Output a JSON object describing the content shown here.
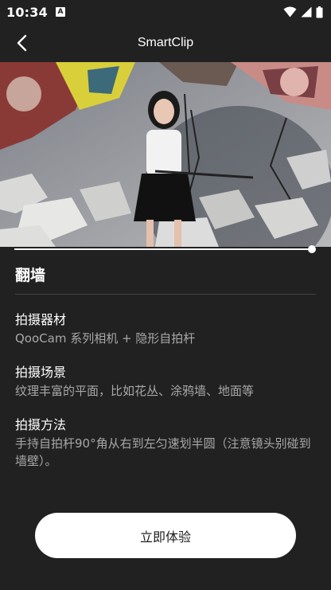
{
  "status_bar": {
    "time": "10:34",
    "app_icon_letter": "A"
  },
  "app_bar": {
    "title": "SmartClip"
  },
  "video": {
    "progress": 1.0
  },
  "section": {
    "title": "翻墙",
    "items": [
      {
        "label": "拍摄器材",
        "value": "QooCam 系列相机 + 隐形自拍杆"
      },
      {
        "label": "拍摄场景",
        "value": "纹理丰富的平面，比如花丛、涂鸦墙、地面等"
      },
      {
        "label": "拍摄方法",
        "value": "手持自拍杆90°角从右到左匀速划半圆（注意镜头别碰到墙壁）。"
      }
    ]
  },
  "cta": {
    "label": "立即体验"
  },
  "colors": {
    "background": "#212121",
    "button_bg": "#ffffff",
    "secondary_text": "#a8a8a8"
  }
}
